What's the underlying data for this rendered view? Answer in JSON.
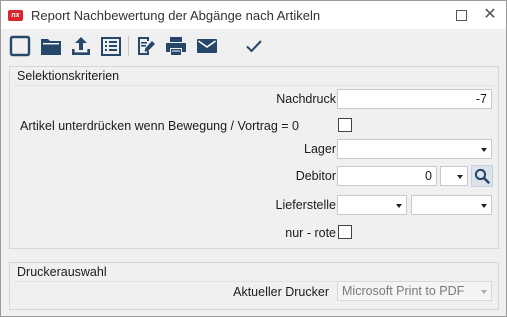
{
  "window": {
    "app_logo": "nx",
    "title": "Report Nachbewertung der Abgänge nach Artikeln",
    "maximize_icon": "maximize-icon",
    "close_icon": "close-icon",
    "close_glyph": "✕"
  },
  "toolbar": {
    "buttons": [
      {
        "name": "new-button",
        "icon": "blank-page-icon"
      },
      {
        "name": "open-button",
        "icon": "folder-icon"
      },
      {
        "name": "export-button",
        "icon": "upload-icon"
      },
      {
        "name": "list-button",
        "icon": "list-icon"
      },
      {
        "name": "edit-button",
        "icon": "edit-icon"
      },
      {
        "name": "print-button",
        "icon": "printer-icon"
      },
      {
        "name": "email-button",
        "icon": "mail-icon"
      },
      {
        "name": "confirm-button",
        "icon": "check-icon"
      }
    ],
    "icon_color": "#25476a"
  },
  "selektion": {
    "title": "Selektionskriterien",
    "nachdruck": {
      "label": "Nachdruck",
      "value": "-7"
    },
    "unterdruecken": {
      "label": "Artikel unterdrücken wenn Bewegung / Vortrag = 0",
      "checked": false
    },
    "lager": {
      "label": "Lager",
      "value": ""
    },
    "debitor": {
      "label": "Debitor",
      "value": "0",
      "search_icon": "search-icon"
    },
    "lieferstelle": {
      "label": "Lieferstelle",
      "value1": "",
      "value2": ""
    },
    "nur_rote": {
      "label": "nur - rote",
      "checked": false
    }
  },
  "drucker": {
    "title": "Druckerauswahl",
    "aktueller_drucker": {
      "label": "Aktueller Drucker",
      "value": "Microsoft Print to PDF"
    }
  }
}
